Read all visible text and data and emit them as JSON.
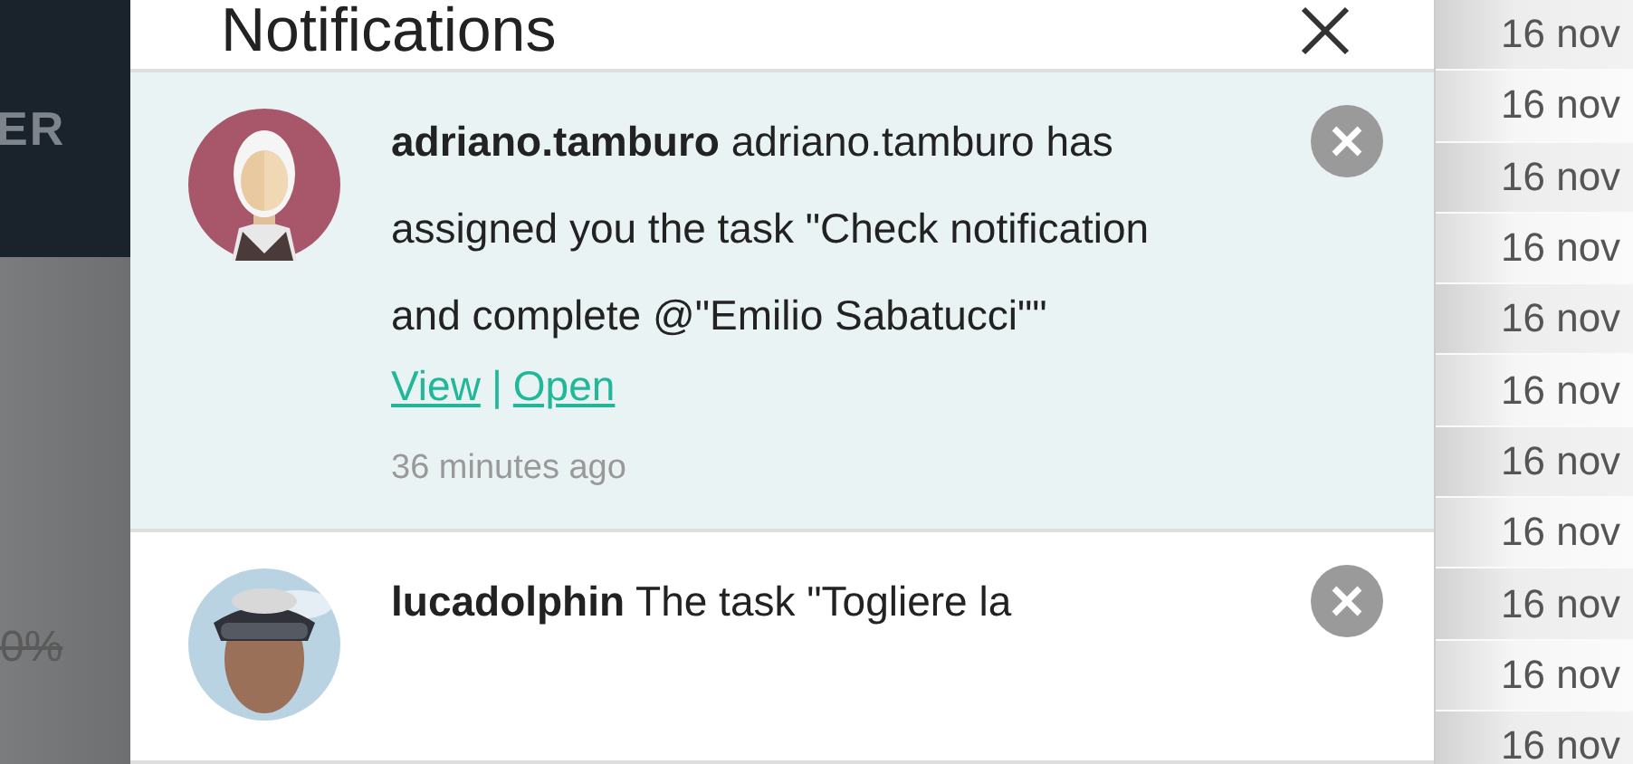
{
  "background_left": {
    "label": "ER",
    "value": "0%"
  },
  "dialog": {
    "title": "Notifications",
    "notifications": [
      {
        "user": "adriano.tamburo",
        "message": "adriano.tamburo has assigned you the task \"Check notification and complete @\"Emilio Sabatucci\"\"",
        "links": [
          "View",
          "Open"
        ],
        "separator": "|",
        "time": "36 minutes ago",
        "unread": true,
        "kind": "illustration"
      },
      {
        "user": "lucadolphin",
        "message": "The task \"Togliere la",
        "unread": false
      }
    ]
  },
  "date_column": [
    "16 nov",
    "16 nov",
    "16 nov",
    "16 nov",
    "16 nov",
    "16 nov",
    "16 nov",
    "16 nov",
    "16 nov",
    "16 nov",
    "16 nov"
  ]
}
